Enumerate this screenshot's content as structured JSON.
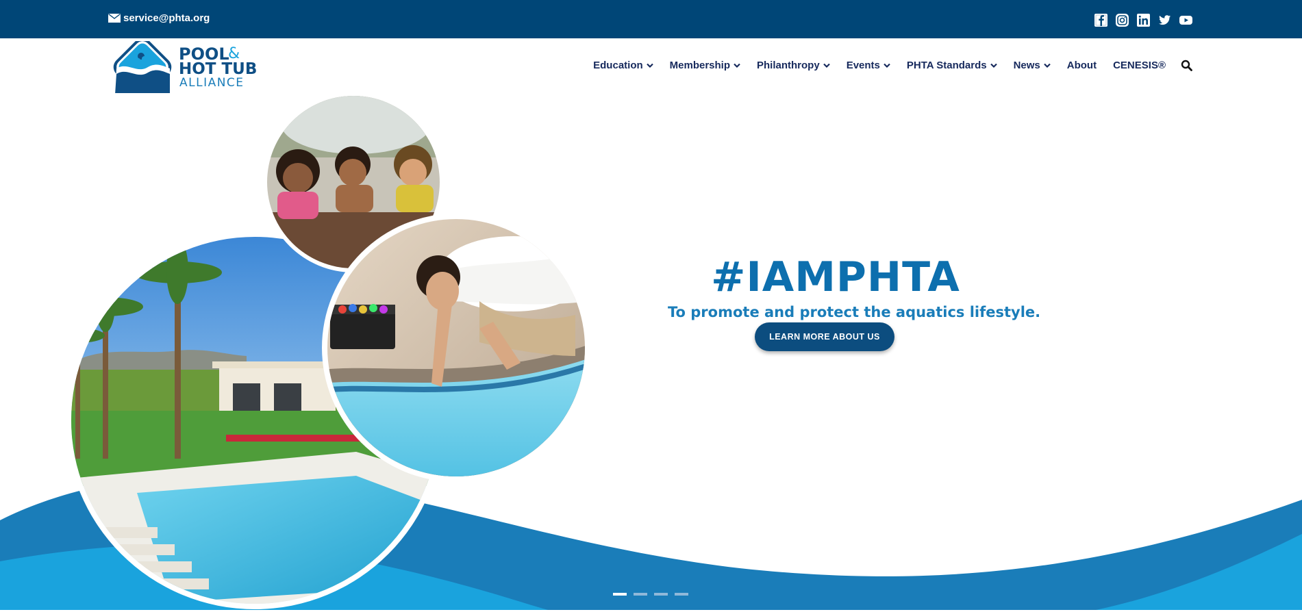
{
  "topbar": {
    "email": "service@phta.org",
    "social_icons": [
      "facebook-icon",
      "instagram-icon",
      "linkedin-icon",
      "twitter-icon",
      "youtube-icon"
    ]
  },
  "logo": {
    "line1": "POOL",
    "amp": "&",
    "line2": "HOT TUB",
    "line3": "ALLIANCE"
  },
  "nav": {
    "items": [
      {
        "label": "Education",
        "dropdown": true
      },
      {
        "label": "Membership",
        "dropdown": true
      },
      {
        "label": "Philanthropy",
        "dropdown": true
      },
      {
        "label": "Events",
        "dropdown": true
      },
      {
        "label": "PHTA Standards",
        "dropdown": true
      },
      {
        "label": "News",
        "dropdown": true
      },
      {
        "label": "About",
        "dropdown": false
      },
      {
        "label": "CENESIS®",
        "dropdown": false
      }
    ],
    "search_icon": "search-icon"
  },
  "hero": {
    "hashtag": "#IAMPHTA",
    "subtitle": "To promote and protect the aquatics lifestyle.",
    "cta_label": "LEARN MORE ABOUT US",
    "slides": 4,
    "active_slide": 1
  },
  "colors": {
    "topbar": "#004677",
    "nav_text": "#16295c",
    "accent": "#0d6fae",
    "wave_dark": "#1a7db9",
    "wave_light": "#1aa3dd",
    "cta": "#0c4d7f"
  }
}
